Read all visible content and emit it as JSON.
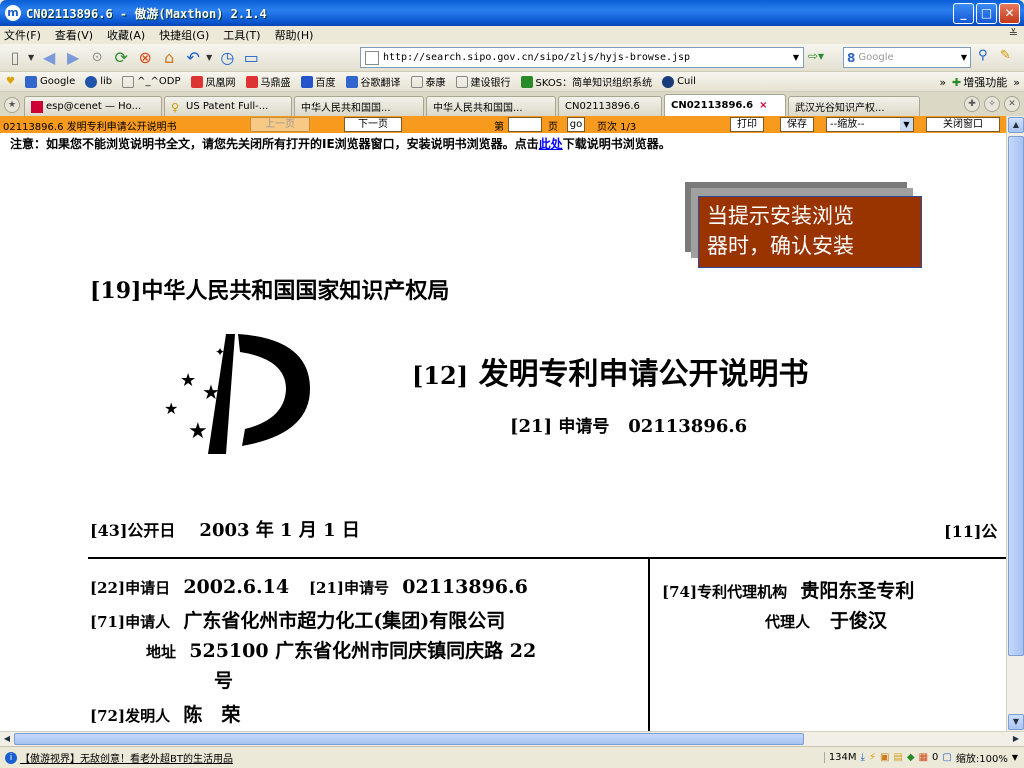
{
  "window": {
    "title": "CN02113896.6 - 傲游(Maxthon) 2.1.4",
    "app_icon": "maxthon-icon"
  },
  "menu": [
    "文件(F)",
    "查看(V)",
    "收藏(A)",
    "快捷组(G)",
    "工具(T)",
    "帮助(H)"
  ],
  "address": {
    "url": "http://search.sipo.gov.cn/sipo/zljs/hyjs-browse.jsp"
  },
  "search": {
    "engine_letter": "8",
    "placeholder": "Google"
  },
  "links": [
    {
      "label": "Google",
      "icon": "google-icon",
      "color": "#3366cc"
    },
    {
      "label": "lib",
      "icon": "lib-icon",
      "color": "#2255aa"
    },
    {
      "label": "^_^ODP",
      "icon": "page-icon",
      "color": "#888888"
    },
    {
      "label": "凤凰网",
      "icon": "ifeng-icon",
      "color": "#d33"
    },
    {
      "label": "马鼎盛",
      "icon": "ifeng-icon",
      "color": "#d33"
    },
    {
      "label": "百度",
      "icon": "baidu-icon",
      "color": "#2255cc"
    },
    {
      "label": "谷歌翻译",
      "icon": "google-icon",
      "color": "#3366cc"
    },
    {
      "label": "泰康",
      "icon": "page-icon",
      "color": "#888888"
    },
    {
      "label": "建设银行",
      "icon": "page-icon",
      "color": "#888888"
    },
    {
      "label": "SKOS：简单知识组织系统",
      "icon": "skos-icon",
      "color": "#2a8a2a"
    },
    {
      "label": "Cuil",
      "icon": "cuil-icon",
      "color": "#1a3c7a"
    }
  ],
  "links_right": {
    "more": "»",
    "enhance": "增强功能"
  },
  "tabs": [
    {
      "label": "esp@cenet — Ho...",
      "active": false
    },
    {
      "label": "US Patent Full-...",
      "active": false
    },
    {
      "label": "中华人民共和国国...",
      "active": false
    },
    {
      "label": "中华人民共和国国...",
      "active": false
    },
    {
      "label": "CN02113896.6",
      "active": false
    },
    {
      "label": "CN02113896.6",
      "active": true
    },
    {
      "label": "武汉光谷知识产权...",
      "active": false
    }
  ],
  "tab_close": "×",
  "viewer": {
    "doc_title": "02113896.6 发明专利申请公开说明书",
    "prev": "上一页",
    "next": "下一页",
    "page_prefix": "第",
    "page_suffix": "页",
    "go": "go",
    "page_count": "页次 1/3",
    "print": "打印",
    "save": "保存",
    "zoom": "--缩放--",
    "close": "关闭窗口"
  },
  "notice": {
    "before": "注意：如果您不能浏览说明书全文，请您先关闭所有打开的IE浏览器窗口，安装说明书浏览器。点击",
    "link": "此处",
    "after": "下载说明书浏览器。"
  },
  "callout": {
    "line1": "当提示安装浏览",
    "line2": "器时，确认安装"
  },
  "patent": {
    "authority": "[19]中华人民共和国国家知识产权局",
    "pub_title_code": "[12]",
    "pub_title": "发明专利申请公开说明书",
    "app_no_code": "[21]",
    "app_no_label": "申请号",
    "app_no": "02113896.6",
    "pub_date_label": "[43]公开日",
    "pub_date": "2003 年 1 月 1 日",
    "pub_no_cut": "[11]公",
    "filing_label": "[22]申请日",
    "filing_date": "2002.6.14",
    "filing_app_label": "[21]申请号",
    "filing_app_no": "02113896.6",
    "applicant_label": "[71]申请人",
    "applicant": "广东省化州市超力化工(集团)有限公司",
    "address_label": "地址",
    "address_line1": "525100 广东省化州市同庆镇同庆路 22",
    "address_line2": "号",
    "inventor_label": "[72]发明人",
    "inventor": "陈　荣",
    "agency_label": "[74]专利代理机构",
    "agency": "贵阳东圣专利",
    "agent_label": "代理人",
    "agent": "于俊汉"
  },
  "status": {
    "text": "【傲游视界】无敌创意！看老外超BT的生活用品",
    "memory": "134M",
    "counter": "0",
    "zoom": "缩放:100%"
  }
}
